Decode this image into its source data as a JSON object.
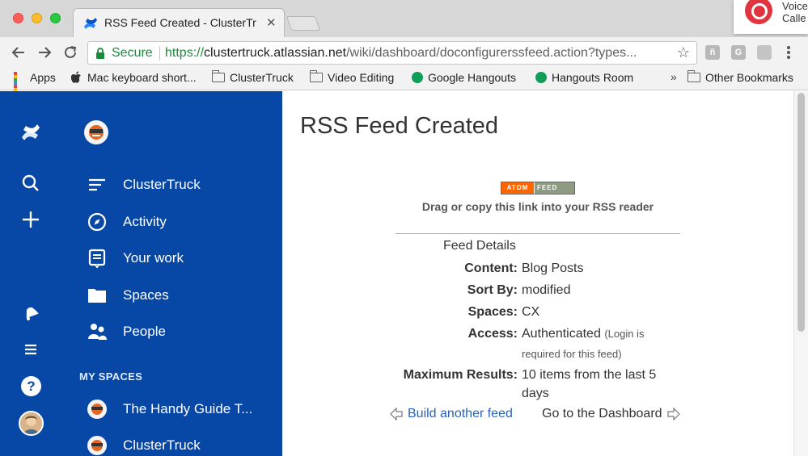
{
  "browser": {
    "tab_title": "RSS Feed Created - ClusterTruck",
    "tab_close": "✕",
    "secure_label": "Secure",
    "url_scheme": "https://",
    "url_host": "clustertruck.atlassian.net",
    "url_path": "/wiki/dashboard/doconfigurerssfeed.action?types...",
    "star": "☆",
    "bookmarks": [
      {
        "label": "Apps",
        "icon": "apps-grid-icon"
      },
      {
        "label": "Mac keyboard short...",
        "icon": "apple-icon"
      },
      {
        "label": "ClusterTruck",
        "icon": "folder-icon"
      },
      {
        "label": "Video Editing",
        "icon": "folder-icon"
      },
      {
        "label": "Google Hangouts",
        "icon": "hangouts-icon"
      },
      {
        "label": "Hangouts Room",
        "icon": "hangouts-icon"
      },
      {
        "label": "Other Bookmarks",
        "icon": "folder-icon"
      }
    ],
    "bookmarks_overflow": "»",
    "notification": {
      "line1": "Voice",
      "line2": "Calle"
    }
  },
  "sidebar": {
    "nav": [
      {
        "label": "ClusterTruck",
        "icon": "space-menu-icon"
      },
      {
        "label": "Activity",
        "icon": "compass-icon"
      },
      {
        "label": "Your work",
        "icon": "your-work-icon"
      },
      {
        "label": "Spaces",
        "icon": "folder-icon"
      },
      {
        "label": "People",
        "icon": "people-icon"
      }
    ],
    "my_spaces_label": "MY SPACES",
    "spaces": [
      {
        "label": "The Handy Guide T..."
      },
      {
        "label": "ClusterTruck"
      }
    ],
    "help_label": "?"
  },
  "main": {
    "title": "RSS Feed Created",
    "atom_badge": {
      "left": "ATOM",
      "right": "FEED"
    },
    "drag_hint": "Drag or copy this link into your RSS reader",
    "details_heading": "Feed Details",
    "details": {
      "content_label": "Content:",
      "content_value": "Blog Posts",
      "sort_label": "Sort By:",
      "sort_value": "modified",
      "spaces_label": "Spaces:",
      "spaces_value": "CX",
      "access_label": "Access:",
      "access_value": "Authenticated",
      "access_note_1": "(Login is",
      "access_note_2": "required for this feed)",
      "max_label": "Maximum Results:",
      "max_value_1": "10 items from the last 5",
      "max_value_2": "days"
    },
    "build_link": "Build another feed",
    "dashboard_link": "Go to the Dashboard"
  },
  "colors": {
    "sidebar_bg": "#0747a6",
    "link": "#2a62b5",
    "secure_green": "#1a8a3c",
    "atom_orange": "#ff6600"
  }
}
